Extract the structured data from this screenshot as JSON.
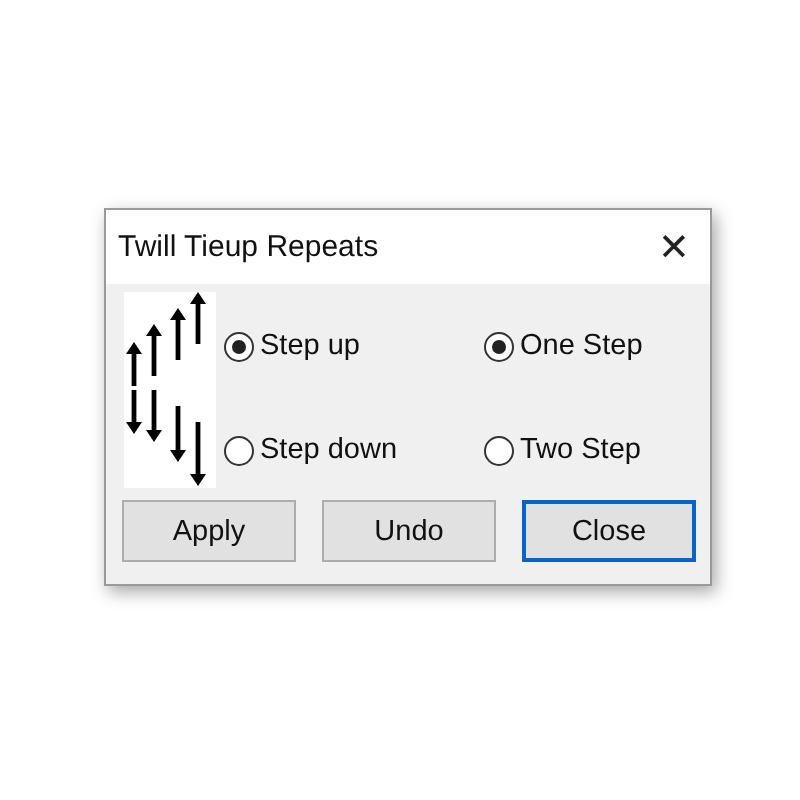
{
  "window": {
    "title": "Twill Tieup Repeats",
    "close": "✕"
  },
  "direction": [
    {
      "label": "Step up",
      "selected": true
    },
    {
      "label": "Step down",
      "selected": false
    }
  ],
  "step": [
    {
      "label": "One Step",
      "selected": true
    },
    {
      "label": "Two Step",
      "selected": false
    }
  ],
  "buttons": [
    {
      "label": "Apply",
      "default": false
    },
    {
      "label": "Undo",
      "default": false
    },
    {
      "label": "Close",
      "default": true
    }
  ]
}
